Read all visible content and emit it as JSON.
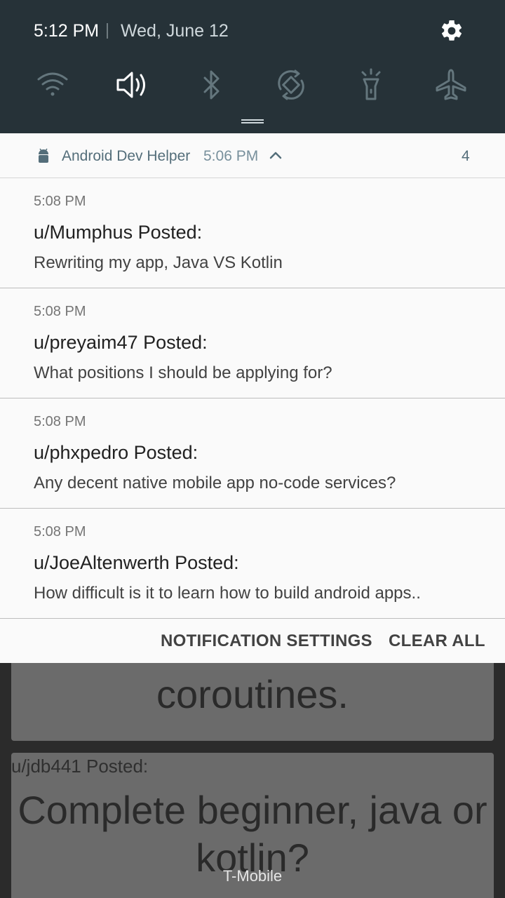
{
  "status_bar": {
    "time": "5:12 PM",
    "date": "Wed, June 12",
    "settings_icon": "gear-icon",
    "quick_settings": [
      {
        "name": "wifi",
        "icon": "wifi-icon",
        "active": false
      },
      {
        "name": "sound",
        "icon": "volume-icon",
        "active": true
      },
      {
        "name": "bluetooth",
        "icon": "bluetooth-icon",
        "active": false
      },
      {
        "name": "auto-rotate",
        "icon": "rotate-icon",
        "active": false
      },
      {
        "name": "flashlight",
        "icon": "flashlight-icon",
        "active": false
      },
      {
        "name": "airplane-mode",
        "icon": "airplane-icon",
        "active": false
      }
    ]
  },
  "notification_group": {
    "app_name": "Android Dev Helper",
    "time": "5:06 PM",
    "count": "4",
    "notifications": [
      {
        "time": "5:08 PM",
        "title": "u/Mumphus Posted:",
        "body": "Rewriting my app, Java VS Kotlin"
      },
      {
        "time": "5:08 PM",
        "title": "u/preyaim47 Posted:",
        "body": "What positions I should be applying for?"
      },
      {
        "time": "5:08 PM",
        "title": "u/phxpedro Posted:",
        "body": "Any decent native mobile app no-code services?"
      },
      {
        "time": "5:08 PM",
        "title": "u/JoeAltenwerth Posted:",
        "body": "How difficult is it to learn how to build android apps.."
      }
    ]
  },
  "actions": {
    "settings_label": "NOTIFICATION SETTINGS",
    "clear_label": "CLEAR ALL"
  },
  "background_app": {
    "card1_title": "coroutines.",
    "card2_user": "u/jdb441 Posted:",
    "card2_title": "Complete beginner, java or kotlin?"
  },
  "carrier": "T-Mobile",
  "colors": {
    "shade_background": "#263238",
    "panel_background": "#fafafa",
    "app_name_color": "#546e7a"
  }
}
